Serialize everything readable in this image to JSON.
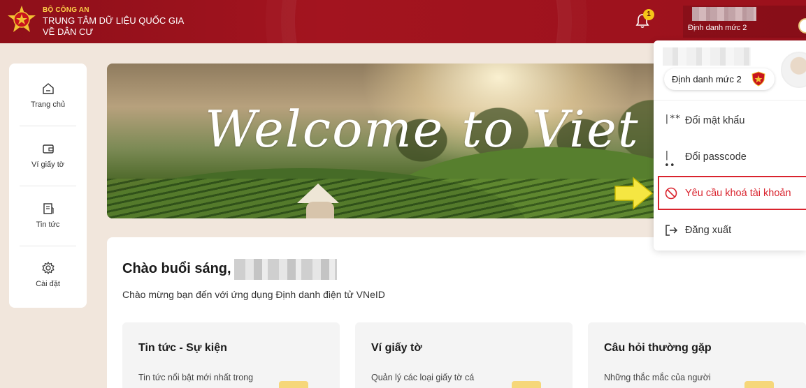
{
  "header": {
    "org_top": "BỘ CÔNG AN",
    "org_name": "TRUNG TÂM DỮ LIỆU QUỐC GIA VỀ DÂN CƯ",
    "notification_count": "1",
    "user_level": "Định danh mức 2",
    "colors": {
      "brand": "#9b111c",
      "badge": "#f5c518"
    }
  },
  "sidebar": {
    "items": [
      {
        "label": "Trang chủ",
        "icon": "home-icon"
      },
      {
        "label": "Ví giấy tờ",
        "icon": "wallet-icon"
      },
      {
        "label": "Tin tức",
        "icon": "news-icon"
      },
      {
        "label": "Cài đặt",
        "icon": "gear-icon"
      }
    ]
  },
  "banner": {
    "text": "Welcome to Viet N"
  },
  "main": {
    "greeting": "Chào buổi sáng,",
    "subtitle": "Chào mừng bạn đến với ứng dụng Định danh điện tử VNeID",
    "cards": [
      {
        "title": "Tin tức - Sự kiện",
        "desc": "Tin tức nổi bật mới nhất trong"
      },
      {
        "title": "Ví giấy tờ",
        "desc": "Quản lý các loại giấy tờ cá"
      },
      {
        "title": "Câu hỏi thường gặp",
        "desc": "Những thắc mắc của người"
      }
    ]
  },
  "dropdown": {
    "level": "Định danh mức 2",
    "items": [
      {
        "label": "Đổi mật khẩu",
        "icon": "password-icon",
        "glyph": "|**"
      },
      {
        "label": "Đổi passcode",
        "icon": "passcode-icon",
        "glyph": "|••"
      },
      {
        "label": "Yêu cầu khoá tài khoản",
        "icon": "block-icon",
        "color": "#d9232d"
      },
      {
        "label": "Đăng xuất",
        "icon": "logout-icon"
      }
    ],
    "highlight_color": "#d9232d",
    "arrow_color": "#f5e642"
  }
}
